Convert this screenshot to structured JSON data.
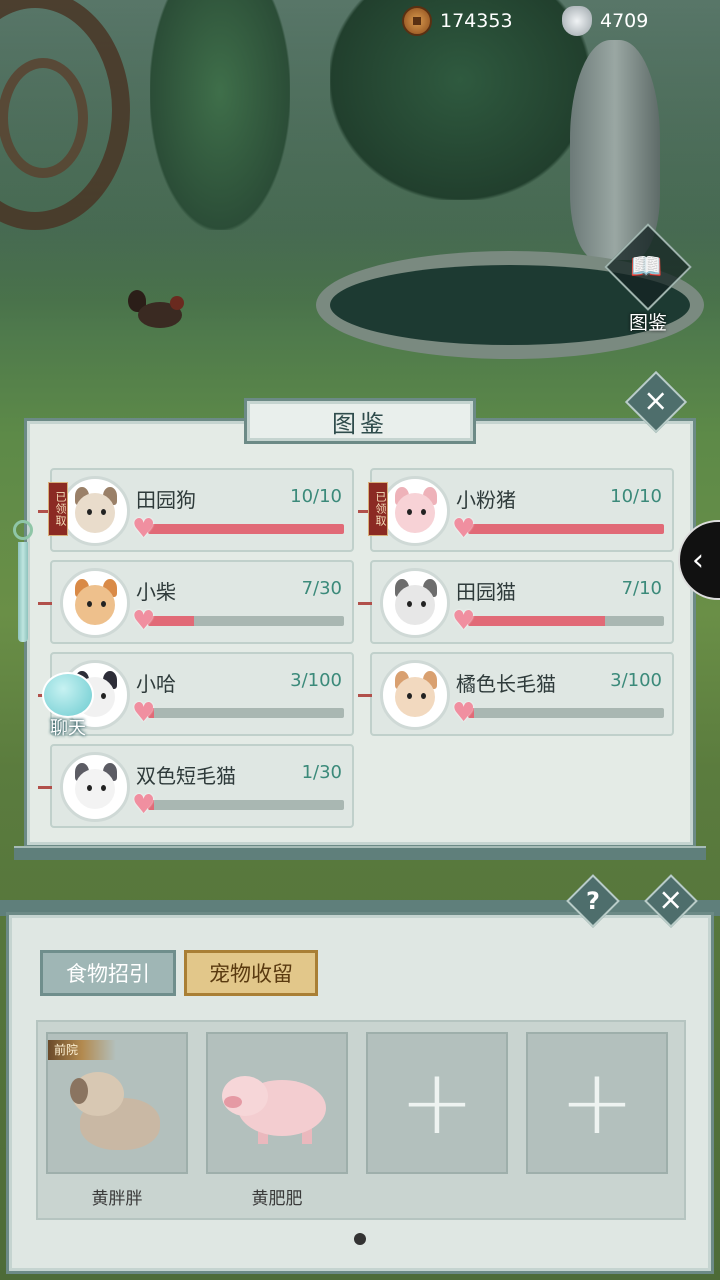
{
  "currency": {
    "coins": "174353",
    "silver": "4709"
  },
  "side_menu": {
    "codex_label": "图鉴"
  },
  "codex": {
    "title": "图鉴",
    "claimed_label": "已领取",
    "cards": [
      {
        "name": "田园狗",
        "count": "10/10",
        "progress": 1.0,
        "claimed": true,
        "face": "#e9dccb",
        "ear": "#9a8068"
      },
      {
        "name": "小粉猪",
        "count": "10/10",
        "progress": 1.0,
        "claimed": true,
        "face": "#f7d2d6",
        "ear": "#eeb2b9"
      },
      {
        "name": "小柴",
        "count": "7/30",
        "progress": 0.233,
        "claimed": false,
        "face": "#eec08c",
        "ear": "#d98a47"
      },
      {
        "name": "田园猫",
        "count": "7/10",
        "progress": 0.7,
        "claimed": false,
        "face": "#e7e7e7",
        "ear": "#6d6d6d"
      },
      {
        "name": "小哈",
        "count": "3/100",
        "progress": 0.03,
        "claimed": false,
        "face": "#f1f1f1",
        "ear": "#2d2d38"
      },
      {
        "name": "橘色长毛猫",
        "count": "3/100",
        "progress": 0.03,
        "claimed": false,
        "face": "#f2d9bf",
        "ear": "#d9a070"
      },
      {
        "name": "双色短毛猫",
        "count": "1/30",
        "progress": 0.033,
        "claimed": false,
        "face": "#f3f3f3",
        "ear": "#5c5c64"
      }
    ]
  },
  "chat": {
    "label": "聊天"
  },
  "bottom": {
    "tabs": {
      "food": "食物招引",
      "shelter": "宠物收留"
    },
    "tag": "前院",
    "slots": [
      {
        "name": "黄胖胖"
      },
      {
        "name": "黄肥肥"
      }
    ],
    "help": "?"
  },
  "colors": {
    "accent_pink": "#e16a77",
    "panel": "#e4ebe6",
    "frame": "#6c8a86",
    "count_text": "#3b8a7a"
  }
}
